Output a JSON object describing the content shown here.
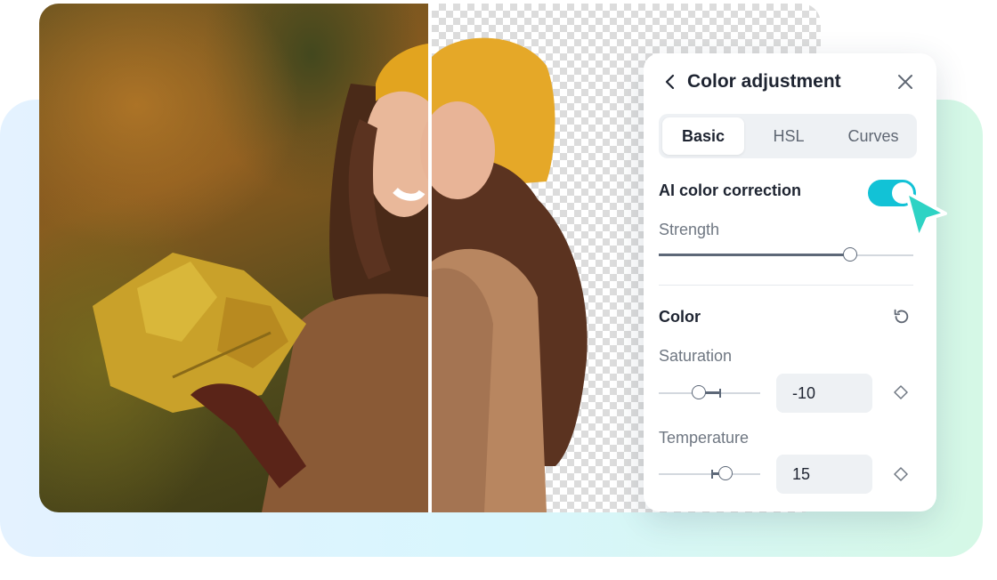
{
  "panel": {
    "title": "Color adjustment",
    "back_icon": "chevron-left-icon",
    "close_icon": "close-icon"
  },
  "tabs": [
    {
      "label": "Basic",
      "active": true
    },
    {
      "label": "HSL",
      "active": false
    },
    {
      "label": "Curves",
      "active": false
    }
  ],
  "ai_correction": {
    "label": "AI color correction",
    "enabled": true,
    "strength_label": "Strength",
    "strength": 0.75
  },
  "color_section": {
    "label": "Color",
    "reset_icon": "reset-icon",
    "saturation": {
      "label": "Saturation",
      "value": "-10"
    },
    "temperature": {
      "label": "Temperature",
      "value": "15"
    }
  },
  "colors": {
    "accent": "#12c2d6",
    "cursor": "#2ed3c4",
    "background_gradient": [
      "#e4f2ff",
      "#d5f8e6"
    ]
  }
}
